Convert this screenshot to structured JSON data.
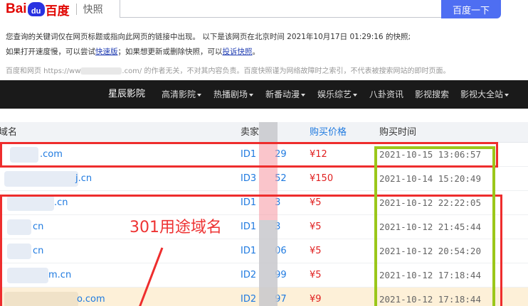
{
  "baidu": {
    "logo_bai": "Bai",
    "logo_du": "du",
    "logo_cn": "百度",
    "snapshot": "快照",
    "search_button": "百度一下"
  },
  "notice": {
    "line1": "您查询的关键词仅在网页标题或指向此网页的链接中出现。  以下是该网页在北京时间 2021年10月17日 01:29:16 的快照;",
    "line2_a": "如果打开速度慢，可以尝试",
    "line2_link1": "快速版",
    "line2_b": "；如果想更新或删除快照，可以",
    "line2_link2": "投诉快照",
    "line2_c": "。"
  },
  "disclaimer": {
    "prefix": "百度和网页 https://ww",
    "suffix": ".com/ 的作者无关，不对其内容负责。百度快照谨为网络故障时之索引，不代表被搜索网站的即时页面。"
  },
  "nav": {
    "brand": "星辰影院",
    "items": [
      "高清影院",
      "热播剧场",
      "新番动漫",
      "娱乐综艺",
      "八卦资讯",
      "影视搜索",
      "影视大全站"
    ]
  },
  "table": {
    "headers": {
      "domain": "域名",
      "seller": "卖家",
      "price": "购买价格",
      "time": "购买时间"
    },
    "rows": [
      {
        "domain": ".com",
        "id_a": "ID1",
        "id_b": "29",
        "price": "¥12",
        "time": "2021-10-15 13:06:57"
      },
      {
        "domain": "j.cn",
        "id_a": "ID3",
        "id_b": "52",
        "price": "¥150",
        "time": "2021-10-14 15:20:49"
      },
      {
        "domain": ".cn",
        "id_a": "ID1",
        "id_b": "3",
        "price": "¥5",
        "time": "2021-10-12 22:22:05"
      },
      {
        "domain": "cn",
        "id_a": "ID1",
        "id_b": "3",
        "price": "¥5",
        "time": "2021-10-12 21:45:44"
      },
      {
        "domain": "cn",
        "id_a": "ID1",
        "id_b": "06",
        "price": "¥5",
        "time": "2021-10-12 20:54:20"
      },
      {
        "domain": "m.cn",
        "id_a": "ID2",
        "id_b": "99",
        "price": "¥5",
        "time": "2021-10-12 17:18:44"
      },
      {
        "domain": "o.com",
        "id_a": "ID2",
        "id_b": "97",
        "price": "¥9",
        "time": "2021-10-12 17:18:44"
      }
    ]
  },
  "annotation": {
    "label": "301用途域名"
  }
}
